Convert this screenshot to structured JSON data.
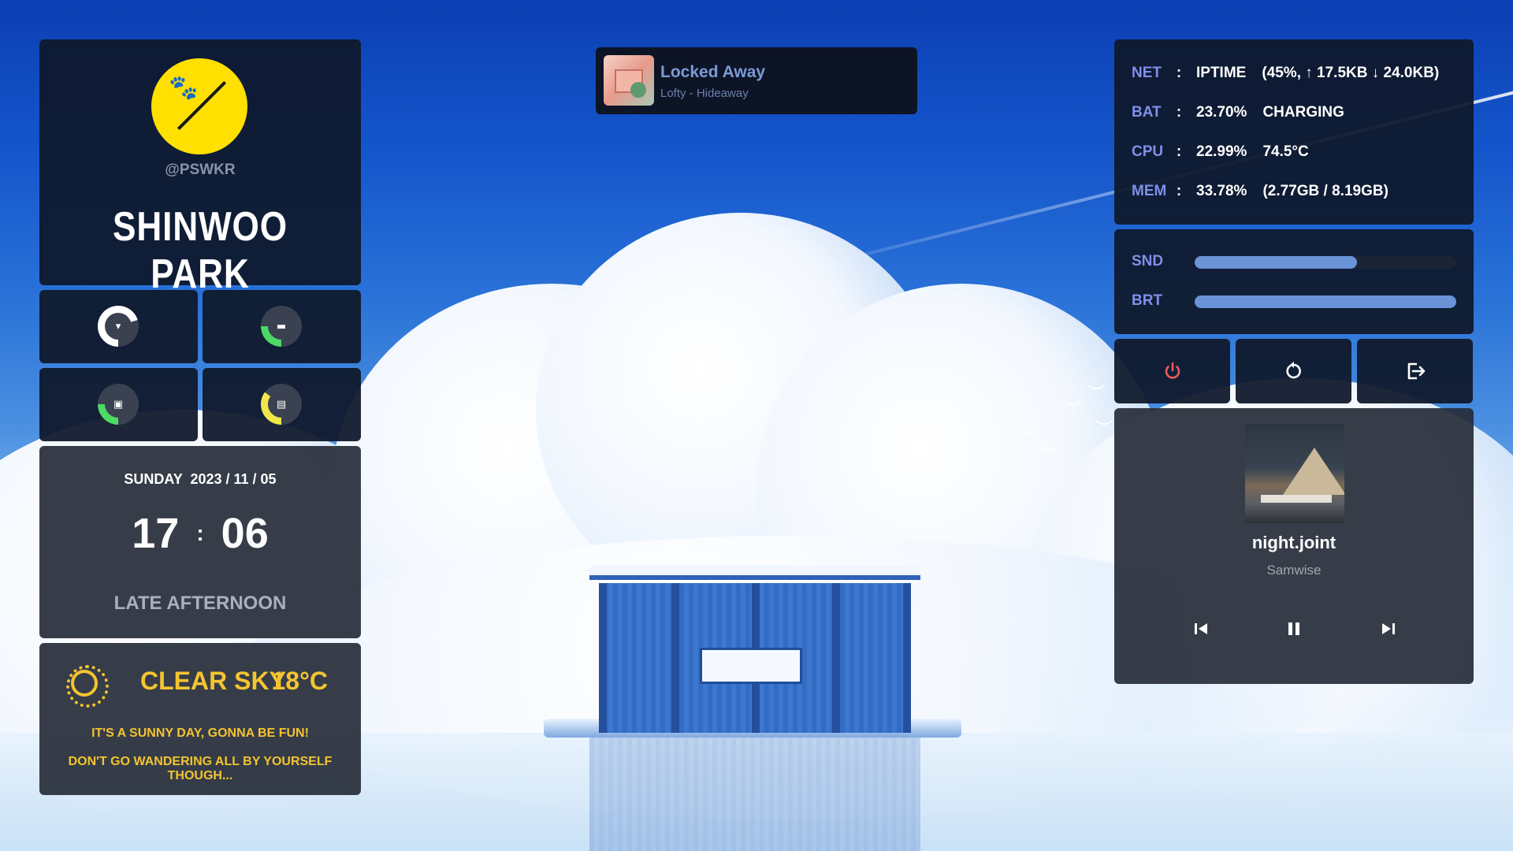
{
  "profile": {
    "handle": "@PSWKR",
    "name": "SHINWOO PARK",
    "avatar_icon": "paw-slash-icon",
    "avatar_color": "#ffe000"
  },
  "rings": [
    {
      "name": "ring-volume",
      "value": 0.7,
      "color": "#ffffff",
      "icon": "volume-icon"
    },
    {
      "name": "ring-battery",
      "value": 0.25,
      "color": "#4cd964",
      "icon": "battery-icon"
    },
    {
      "name": "ring-cpu",
      "value": 0.25,
      "color": "#4cd964",
      "icon": "cpu-icon"
    },
    {
      "name": "ring-memory",
      "value": 0.35,
      "color": "#f0e84a",
      "icon": "memory-icon"
    }
  ],
  "clock": {
    "date": "SUNDAY  2023 / 11 / 05",
    "hour": "17",
    "sep": ":",
    "minute": "06",
    "period": "LATE AFTERNOON"
  },
  "weather": {
    "icon": "sun-icon",
    "condition": "CLEAR SKY",
    "temp": "18°C",
    "line1": "IT'S A SUNNY DAY, GONNA BE FUN!",
    "line2": "DON'T GO WANDERING ALL BY YOURSELF THOUGH...",
    "color": "#f4c430"
  },
  "toast": {
    "title": "Locked Away",
    "subtitle": "Lofty - Hideaway"
  },
  "stats": {
    "net": {
      "key": "NET",
      "sep": ":",
      "value": "IPTIME",
      "detail": "(45%, ↑ 17.5KB ↓ 24.0KB)"
    },
    "bat": {
      "key": "BAT",
      "sep": ":",
      "value": "23.70%",
      "detail": "CHARGING"
    },
    "cpu": {
      "key": "CPU",
      "sep": ":",
      "value": "22.99%",
      "detail": "74.5°C"
    },
    "mem": {
      "key": "MEM",
      "sep": ":",
      "value": "33.78%",
      "detail": "(2.77GB / 8.19GB)"
    }
  },
  "sliders": {
    "snd": {
      "label": "SND",
      "value": 0.62
    },
    "brt": {
      "label": "BRT",
      "value": 1.0
    }
  },
  "power": {
    "shutdown_icon": "power-icon",
    "reboot_icon": "restart-icon",
    "logout_icon": "logout-icon",
    "shutdown_color": "#e85a5a"
  },
  "music": {
    "title": "night.joint",
    "artist": "Samwise",
    "prev_icon": "skip-previous-icon",
    "pause_icon": "pause-icon",
    "next_icon": "skip-next-icon"
  }
}
